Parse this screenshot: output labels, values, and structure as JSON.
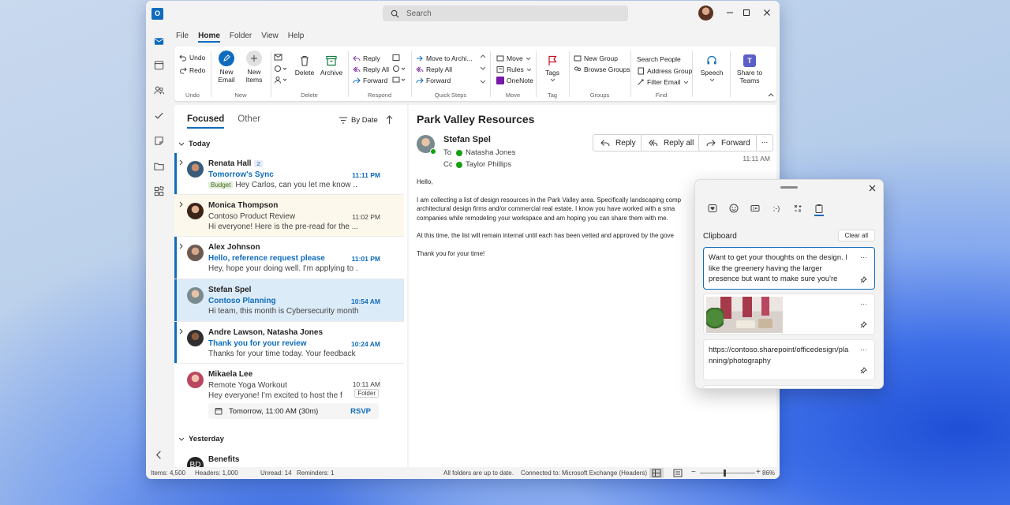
{
  "window": {
    "app_logo": "O",
    "search_placeholder": "Search",
    "icons": {
      "search": "search-icon",
      "minimize": "minimize-icon",
      "maximize": "maximize-icon",
      "close": "close-icon"
    }
  },
  "menu": [
    "File",
    "Home",
    "Folder",
    "View",
    "Help"
  ],
  "menu_active": "Home",
  "ribbon": {
    "undo": "Undo",
    "redo": "Redo",
    "new_email": "New Email",
    "new_items": "New Items",
    "delete": "Delete",
    "archive": "Archive",
    "reply": "Reply",
    "reply_all": "Reply All",
    "forward": "Forward",
    "move_to_archive": "Move to Archi...",
    "qs_reply_all": "Reply All",
    "qs_forward": "Forward",
    "move": "Move",
    "rules": "Rules",
    "onenote": "OneNote",
    "tags": "Tags",
    "new_group": "New Group",
    "browse_groups": "Browse Groups",
    "search_people": "Search People",
    "address_group": "Address Group",
    "filter_email": "Filter Email",
    "speech": "Speech",
    "share_to_teams": "Share to Teams",
    "groups": [
      "Undo",
      "New",
      "Delete",
      "Respond",
      "Quick Steps",
      "Move",
      "Tag",
      "Groups",
      "Find"
    ]
  },
  "list": {
    "tab_focused": "Focused",
    "tab_other": "Other",
    "sort": "By Date",
    "group_today": "Today",
    "group_yesterday": "Yesterday",
    "messages": [
      {
        "from": "Renata Hall",
        "count": "2",
        "subject": "Tomorrow's Sync",
        "time": "11:11 PM",
        "tag": "Budget",
        "preview": "Hey Carlos, can you let me know ...",
        "unread": true
      },
      {
        "from": "Monica Thompson",
        "subject": "Contoso Product Review",
        "time": "11:02 PM",
        "preview": "Hi everyone! Here is the pre-read for the ...",
        "unread": false
      },
      {
        "from": "Alex Johnson",
        "subject": "Hello, reference request please",
        "time": "11:01 PM",
        "preview": "Hey, hope your doing well. I'm applying to ...",
        "unread": true
      },
      {
        "from": "Stefan Spel",
        "subject": "Contoso Planning",
        "time": "10:54 AM",
        "preview": "Hi team, this month is Cybersecurity month!",
        "unread": true
      },
      {
        "from": "Andre Lawson, Natasha Jones",
        "subject": "Thank you for your review",
        "time": "10:24 AM",
        "preview": "Thanks for your time today. Your feedback ...",
        "unread": true
      },
      {
        "from": "Mikaela Lee",
        "subject": "Remote Yoga Workout",
        "time": "10:11 AM",
        "preview": "Hey everyone! I'm excited to host the firs...",
        "folder": "Folder",
        "event": "Tomorrow, 11:00 AM (30m)",
        "rsvp": "RSVP",
        "unread": false
      },
      {
        "from": "Benefits",
        "initials": "BD",
        "subject": "",
        "time": "",
        "preview": ""
      }
    ]
  },
  "reading": {
    "title": "Park Valley Resources",
    "sender": "Stefan Spel",
    "to_label": "To",
    "to": "Natasha Jones",
    "cc_label": "Cc",
    "cc": "Taylor Phillips",
    "reply": "Reply",
    "reply_all": "Reply all",
    "forward": "Forward",
    "more": "...",
    "time": "11:11 AM",
    "body": [
      "Hello,",
      "I am collecting a list of design resources in the Park Valley area. Specifically landscaping comp",
      "architectural design firms and/or commercial real estate. I know you have worked with a sma",
      "companies while remodeling your workspace and am hoping you can share them with me.",
      "At this time, the list will remain internal until each has been vetted and approved by the gove",
      "Thank you for your time!"
    ]
  },
  "status": {
    "items": "Items: 4,500",
    "headers": "Headers: 1,000",
    "unread": "Unread: 14",
    "reminders": "Reminders: 1",
    "sync": "All folders are up to date.",
    "connection": "Connected to: Microsoft Exchange (Headers)",
    "zoom": "86%",
    "zoom_level": 0.86
  },
  "clipboard": {
    "title": "Clipboard",
    "clear_all": "Clear all",
    "items": [
      {
        "text": "Want to get your thoughts on the design. I like the greenery having the larger presence but want to make sure you're"
      },
      {
        "image": "office-photo"
      },
      {
        "text": "https://contoso.sharepoint/officedesign/planning/photography"
      }
    ],
    "more": "···"
  },
  "colors": {
    "accent": "#0f6cbd",
    "selected": "#dcebf8",
    "presence": "#13a10e",
    "teams": "#5b5fc7",
    "flag": "#c50f1f",
    "archive": "#107c41"
  }
}
